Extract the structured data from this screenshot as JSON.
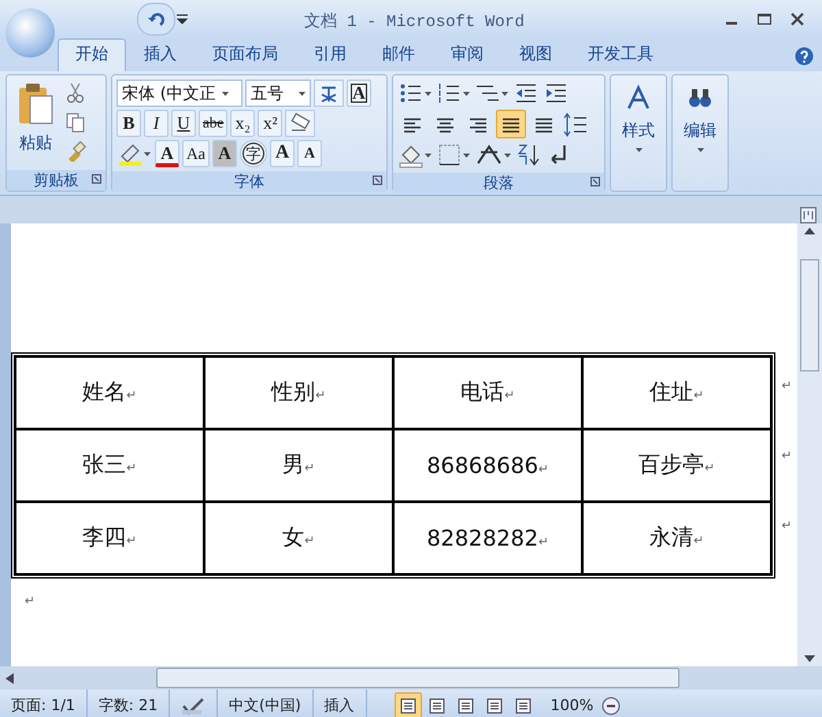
{
  "window": {
    "title": "文档 1 - Microsoft Word"
  },
  "tabs": [
    {
      "label": "开始",
      "selected": true
    },
    {
      "label": "插入",
      "selected": false
    },
    {
      "label": "页面布局",
      "selected": false
    },
    {
      "label": "引用",
      "selected": false
    },
    {
      "label": "邮件",
      "selected": false
    },
    {
      "label": "审阅",
      "selected": false
    },
    {
      "label": "视图",
      "selected": false
    },
    {
      "label": "开发工具",
      "selected": false
    }
  ],
  "clipboard": {
    "label": "剪贴板",
    "paste": "粘贴"
  },
  "font": {
    "label": "字体",
    "name": "宋体 (中文正",
    "size": "五号",
    "boxed": "A",
    "bold": "B",
    "italic": "I",
    "underline": "U",
    "strike": "abe",
    "sub": "x₂",
    "sup": "x²",
    "font_color": "A",
    "case": "Aa",
    "shade": "A",
    "enclose": "字",
    "grow": "A",
    "shrink": "A"
  },
  "paragraph": {
    "label": "段落",
    "alignments": [
      {
        "selected": false
      },
      {
        "selected": false
      },
      {
        "selected": false
      },
      {
        "selected": true
      },
      {
        "selected": false
      }
    ]
  },
  "styles": {
    "label": "样式"
  },
  "editing": {
    "label": "编辑"
  },
  "table": {
    "rows": [
      {
        "cells": [
          {
            "text": "姓名",
            "mark": "↵"
          },
          {
            "text": "性别",
            "mark": "↵"
          },
          {
            "text": "电话",
            "mark": "↵"
          },
          {
            "text": "住址",
            "mark": "↵"
          }
        ],
        "end_mark": "↵"
      },
      {
        "cells": [
          {
            "text": "张三",
            "mark": "↵"
          },
          {
            "text": "男",
            "mark": "↵"
          },
          {
            "text": "86868686",
            "mark": "↵"
          },
          {
            "text": "百步亭",
            "mark": "↵"
          }
        ],
        "end_mark": "↵"
      },
      {
        "cells": [
          {
            "text": "李四",
            "mark": "↵"
          },
          {
            "text": "女",
            "mark": "↵"
          },
          {
            "text": "82828282",
            "mark": "↵"
          },
          {
            "text": "永清",
            "mark": "↵"
          }
        ],
        "end_mark": "↵"
      }
    ]
  },
  "after_mark": "↵",
  "status_bar": {
    "page": "页面: 1/1",
    "words": "字数: 21",
    "language": "中文(中国)",
    "mode": "插入",
    "views": [
      {
        "selected": true
      },
      {
        "selected": false
      },
      {
        "selected": false
      },
      {
        "selected": false
      },
      {
        "selected": false
      }
    ],
    "zoom": "100%"
  }
}
